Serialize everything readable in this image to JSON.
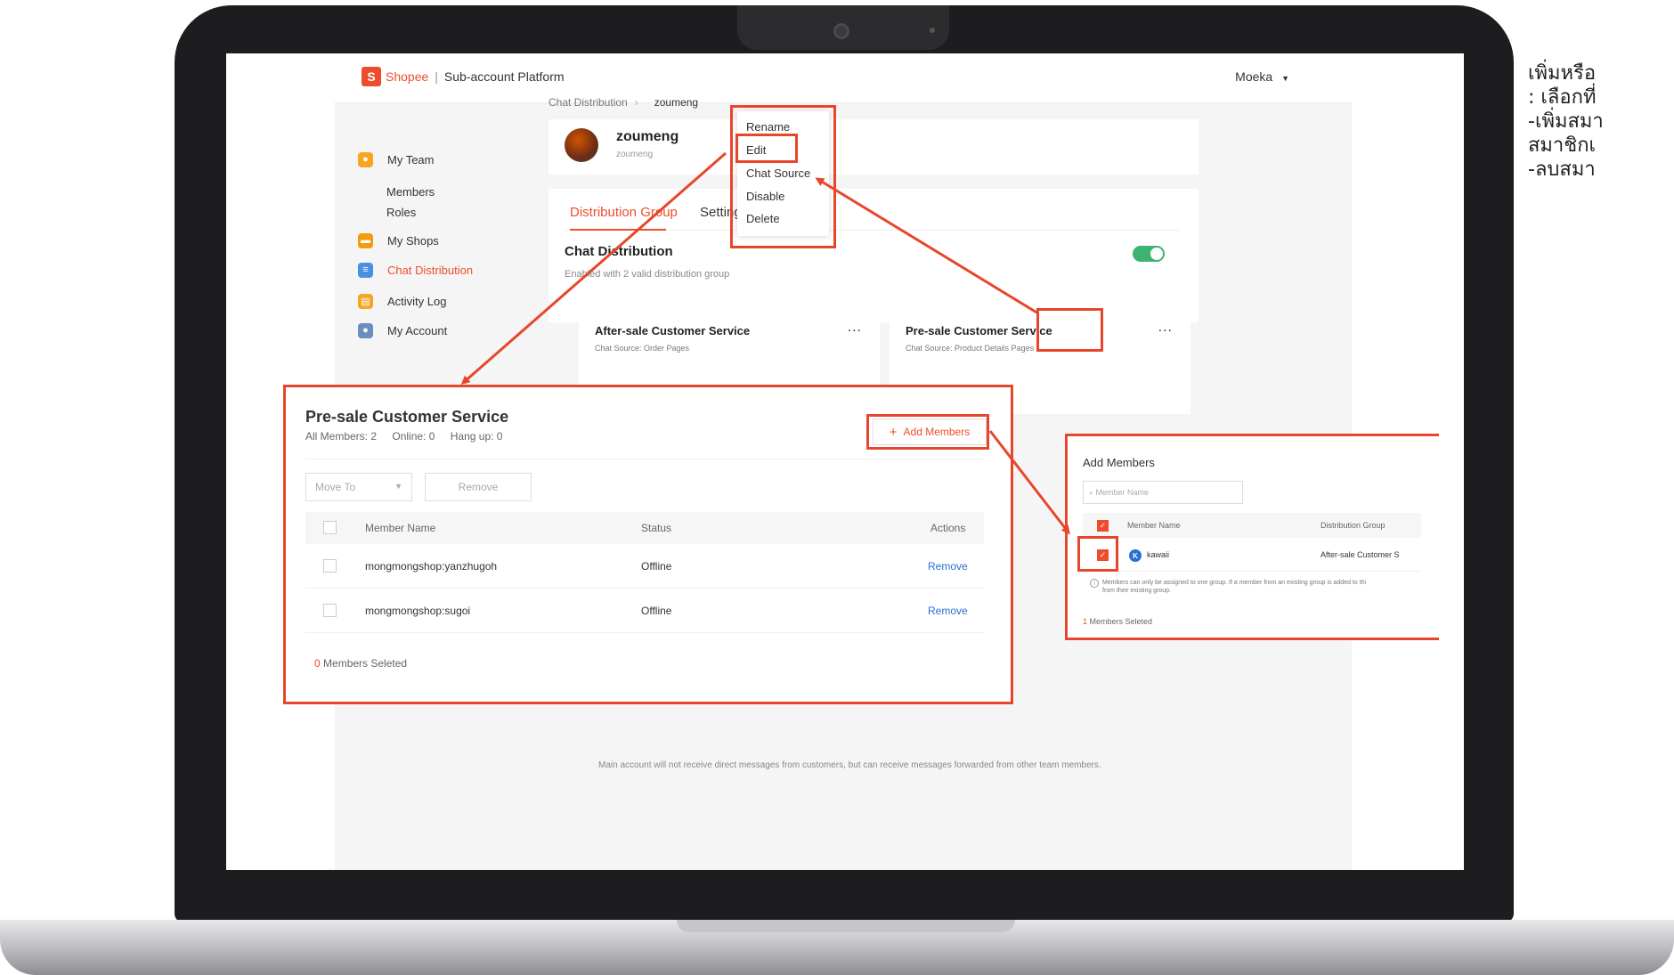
{
  "app": {
    "brand": "Shopee",
    "platform": "Sub-account Platform",
    "user": "Moeka"
  },
  "sidebar": {
    "my_team": "My Team",
    "members": "Members",
    "roles": "Roles",
    "my_shops": "My Shops",
    "chat_distribution": "Chat Distribution",
    "activity_log": "Activity Log",
    "my_account": "My Account"
  },
  "breadcrumb": {
    "parent": "Chat Distribution",
    "current": "zoumeng"
  },
  "profile": {
    "name": "zoumeng",
    "sub": "zoumeng"
  },
  "menu": {
    "rename": "Rename",
    "edit": "Edit",
    "chat_source": "Chat Source",
    "disable": "Disable",
    "delete": "Delete"
  },
  "tabs": {
    "distribution_group": "Distribution Group",
    "settings": "Settings"
  },
  "chat_distribution": {
    "title": "Chat Distribution",
    "subtitle": "Enabled with 2 valid distribution group",
    "enabled": true
  },
  "groups": [
    {
      "title": "After-sale Customer Service",
      "source": "Chat Source: Order Pages"
    },
    {
      "title": "Pre-sale Customer Service",
      "source": "Chat Source: Product Details Pages"
    }
  ],
  "more_glyph": "...",
  "footer_note": "Main account will not receive direct messages from customers, but can receive messages forwarded from other team members.",
  "panel": {
    "title": "Pre-sale Customer Service",
    "all_members": "All Members: 2",
    "online": "Online: 0",
    "hang_up": "Hang up: 0",
    "add_members": "Add Members",
    "move_to": "Move To",
    "remove": "Remove",
    "columns": {
      "name": "Member Name",
      "status": "Status",
      "actions": "Actions"
    },
    "rows": [
      {
        "name": "mongmongshop:yanzhugoh",
        "status": "Offline",
        "action": "Remove"
      },
      {
        "name": "mongmongshop:sugoi",
        "status": "Offline",
        "action": "Remove"
      }
    ],
    "selected_count": "0",
    "selected_label": "Members Seleted"
  },
  "add_members_dialog": {
    "title": "Add Members",
    "search_placeholder": "Member Name",
    "columns": {
      "name": "Member Name",
      "group": "Distribution Group"
    },
    "row": {
      "initial": "K",
      "name": "kawaii",
      "group": "After-sale Customer S"
    },
    "note_line1": "Members can only be assigned to one group. If a member from an existing group is added to thi",
    "note_line2": "from their existing group.",
    "selected_count": "1",
    "selected_label": "Members Seleted"
  },
  "annotation_text": {
    "line1": "เพิ่มหรือ",
    "line2": ": เลือกที่",
    "line3": "-เพิ่มสมา",
    "line4": "สมาชิกเ",
    "line5": "-ลบสมา"
  },
  "colors": {
    "brand": "#ee4d2d",
    "highlight": "#e8462c",
    "toggle_on": "#3cb371",
    "link": "#2a6ed2"
  }
}
